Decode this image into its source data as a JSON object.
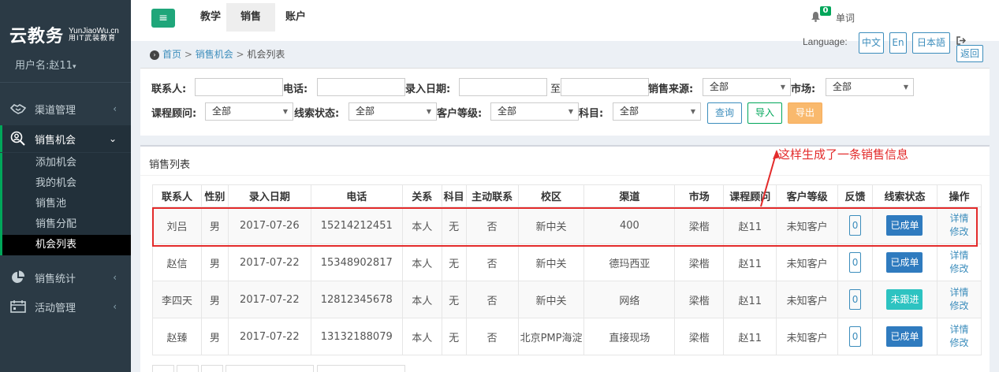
{
  "app": {
    "logo_main": "云教务",
    "logo_sub_en": "YunJiaoWu.cn",
    "logo_sub_cn": "用IT武装教育",
    "username": "用户名:赵11"
  },
  "sidebar": {
    "items": [
      {
        "label": "渠道管理",
        "icon": "handshake-icon"
      },
      {
        "label": "销售机会",
        "icon": "user-search-icon"
      },
      {
        "label": "销售统计",
        "icon": "pie-chart-icon"
      },
      {
        "label": "活动管理",
        "icon": "calendar-icon"
      }
    ],
    "sub_items": [
      "添加机会",
      "我的机会",
      "销售池",
      "销售分配",
      "机会列表"
    ]
  },
  "header": {
    "tabs": [
      "教学",
      "销售",
      "账户"
    ],
    "notification_count": "0",
    "notification_label": "单词",
    "language_label": "Language:",
    "languages": [
      "中文",
      "En",
      "日本語"
    ],
    "accent_color": "#1fa67a"
  },
  "breadcrumb": {
    "home": "首页",
    "parent": "销售机会",
    "current": "机会列表",
    "back_label": "返回"
  },
  "filters": {
    "contact_label": "联系人:",
    "contact_value": "",
    "phone_label": "电话:",
    "phone_value": "",
    "date_label": "录入日期:",
    "date_to": "至",
    "source_label": "销售来源:",
    "source_value": "全部",
    "market_label": "市场:",
    "market_value": "全部",
    "advisor_label": "课程顾问:",
    "advisor_value": "全部",
    "lead_status_label": "线索状态:",
    "lead_status_value": "全部",
    "customer_level_label": "客户等级:",
    "customer_level_value": "全部",
    "subject_label": "科目:",
    "subject_value": "全部",
    "query_button": "查询",
    "import_button": "导入",
    "export_button": "导出"
  },
  "list": {
    "title": "销售列表",
    "columns": [
      "联系人",
      "性别",
      "录入日期",
      "电话",
      "关系",
      "科目",
      "主动联系",
      "校区",
      "渠道",
      "市场",
      "课程顾问",
      "客户等级",
      "反馈",
      "线索状态",
      "操作"
    ],
    "rows": [
      {
        "name": "刘吕",
        "gender": "男",
        "date": "2017-07-26",
        "phone": "15214212451",
        "relation": "本人",
        "subject": "无",
        "active": "否",
        "campus": "新中关",
        "channel": "400",
        "market": "梁楷",
        "advisor": "赵11",
        "level": "未知客户",
        "feedback": "0",
        "status": "已成单",
        "status_color": "#2f7bbf",
        "op1": "详情",
        "op2": "修改"
      },
      {
        "name": "赵信",
        "gender": "男",
        "date": "2017-07-22",
        "phone": "15348902817",
        "relation": "本人",
        "subject": "无",
        "active": "否",
        "campus": "新中关",
        "channel": "德玛西亚",
        "market": "梁楷",
        "advisor": "赵11",
        "level": "未知客户",
        "feedback": "0",
        "status": "已成单",
        "status_color": "#2f7bbf",
        "op1": "详情",
        "op2": "修改"
      },
      {
        "name": "李四天",
        "gender": "男",
        "date": "2017-07-22",
        "phone": "12812345678",
        "relation": "本人",
        "subject": "无",
        "active": "否",
        "campus": "新中关",
        "channel": "网络",
        "market": "梁楷",
        "advisor": "赵11",
        "level": "未知客户",
        "feedback": "0",
        "status": "未跟进",
        "status_color": "#2dc3c1",
        "op1": "详情",
        "op2": "修改"
      },
      {
        "name": "赵臻",
        "gender": "男",
        "date": "2017-07-22",
        "phone": "13132188079",
        "relation": "本人",
        "subject": "无",
        "active": "否",
        "campus": "北京PMP海淀",
        "channel": "直接现场",
        "market": "梁楷",
        "advisor": "赵11",
        "level": "未知客户",
        "feedback": "0",
        "status": "已成单",
        "status_color": "#2f7bbf",
        "op1": "详情",
        "op2": "修改"
      }
    ]
  },
  "annotation": {
    "text": "这样生成了一条销售信息",
    "color": "#e32b2b"
  }
}
